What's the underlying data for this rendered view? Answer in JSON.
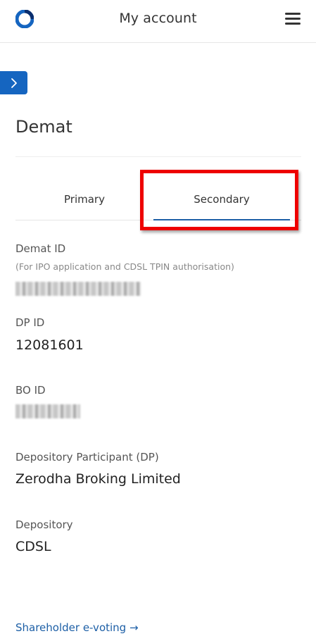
{
  "header": {
    "title": "My account"
  },
  "colors": {
    "accent": "#1565c0",
    "link": "#1d5fa6",
    "highlight": "#ee0000"
  },
  "page": {
    "title": "Demat"
  },
  "tabs": [
    {
      "label": "Primary",
      "selected": false
    },
    {
      "label": "Secondary",
      "selected": true
    }
  ],
  "fields": {
    "demat_id": {
      "label": "Demat ID",
      "note": "(For IPO application and CDSL TPIN authorisation)"
    },
    "dp_id": {
      "label": "DP ID",
      "value": "12081601"
    },
    "bo_id": {
      "label": "BO ID"
    },
    "depository_participant": {
      "label": "Depository Participant (DP)",
      "value": "Zerodha Broking Limited"
    },
    "depository": {
      "label": "Depository",
      "value": "CDSL"
    }
  },
  "links": {
    "shareholder_evoting": "Shareholder e-voting →"
  },
  "icons": {
    "logo": "zerodha-logo",
    "menu": "hamburger-menu-icon",
    "expand": "chevron-right-icon"
  }
}
